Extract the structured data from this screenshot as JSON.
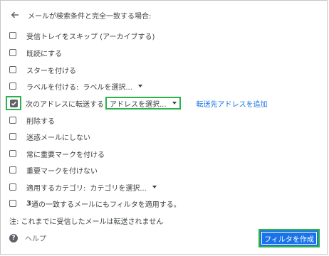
{
  "header": {
    "title": "メールが検索条件と完全一致する場合:"
  },
  "options": [
    {
      "label": "受信トレイをスキップ (アーカイブする)",
      "checked": false
    },
    {
      "label": "既読にする",
      "checked": false
    },
    {
      "label": "スターを付ける",
      "checked": false
    },
    {
      "label": "ラベルを付ける:",
      "dropdown": "ラベルを選択...",
      "checked": false
    },
    {
      "label": "次のアドレスに転送する",
      "dropdown": "アドレスを選択...",
      "link": "転送先アドレスを追加",
      "checked": true
    },
    {
      "label": "削除する",
      "checked": false
    },
    {
      "label": "迷惑メールにしない",
      "checked": false
    },
    {
      "label": "常に重要マークを付ける",
      "checked": false
    },
    {
      "label": "重要マークを付けない",
      "checked": false
    },
    {
      "label": "適用するカテゴリ:",
      "dropdown": "カテゴリを選択...",
      "checked": false
    },
    {
      "label_bold": "3",
      "label": " 通の一致するメールにもフィルタを適用する。",
      "checked": false
    }
  ],
  "note": "注: これまでに受信したメールは転送されません",
  "footer": {
    "help_label": "ヘルプ",
    "create_button": "フィルタを作成"
  },
  "colors": {
    "accent": "#1a73e8",
    "highlight": "#2ab24b"
  },
  "icons": {
    "back": "arrow-left-icon",
    "help": "help-icon",
    "dropdown": "caret-down-icon"
  }
}
